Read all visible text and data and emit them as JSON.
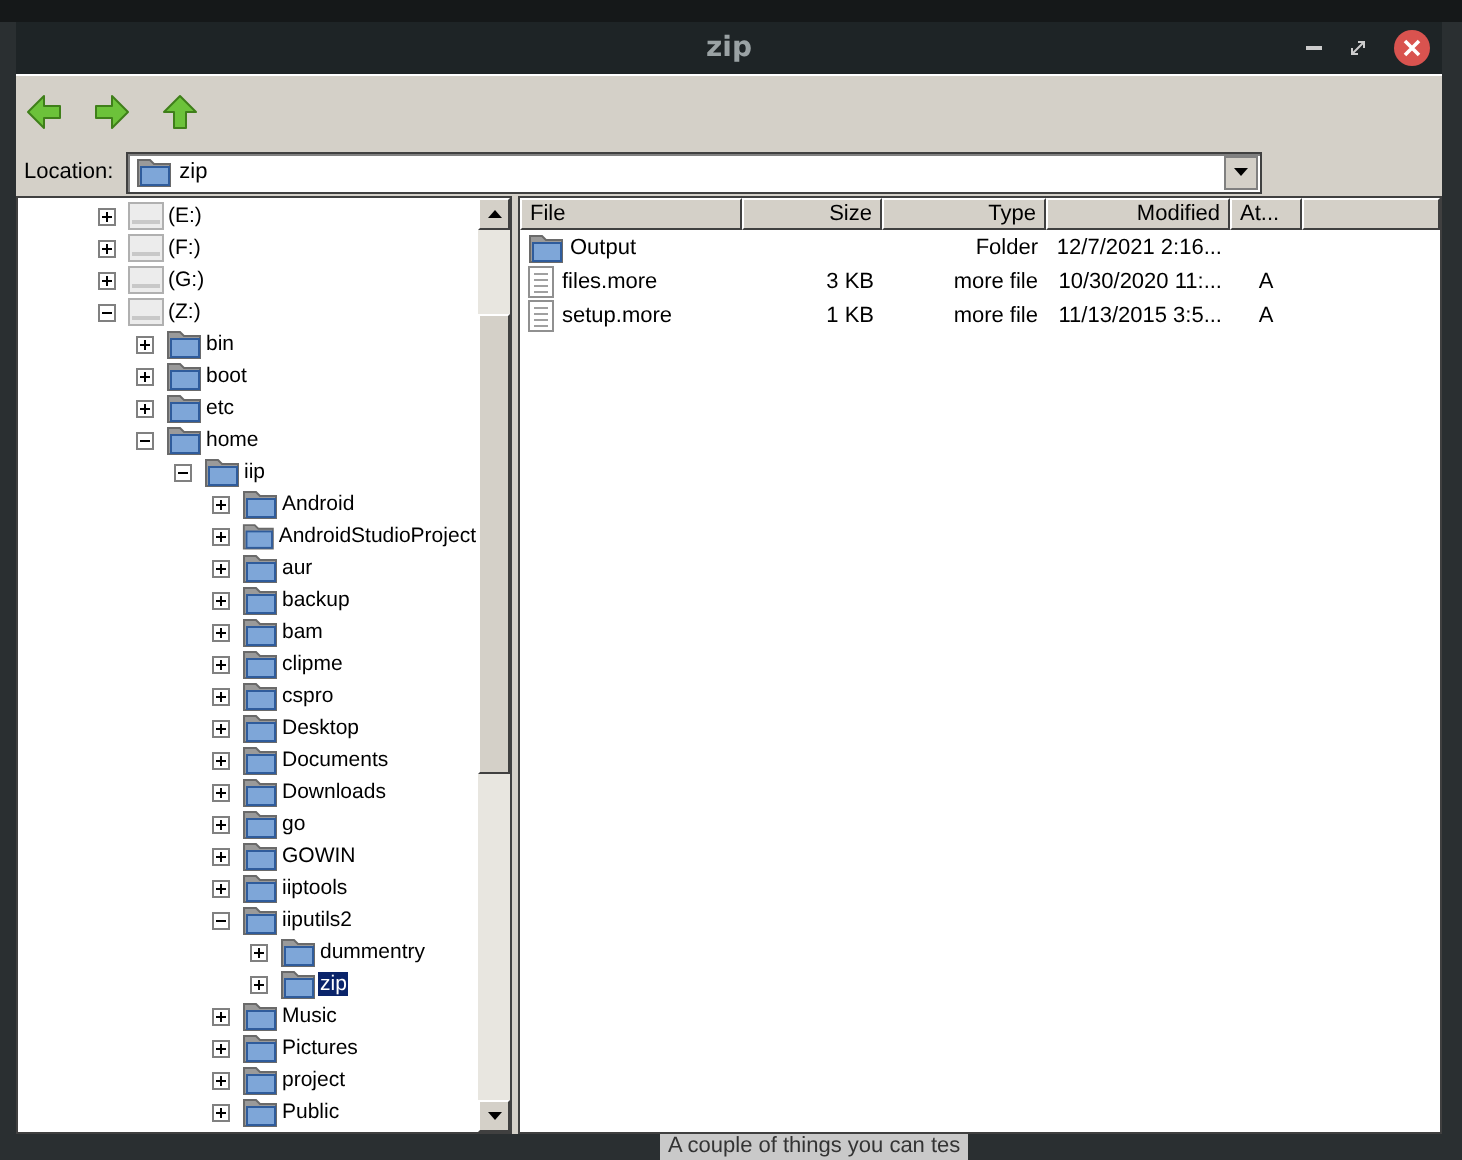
{
  "window": {
    "title": "zip"
  },
  "location": {
    "label": "Location:",
    "value": "zip"
  },
  "tree": [
    {
      "kind": "drive",
      "label": "(E:)",
      "expanded": false,
      "selected": false
    },
    {
      "kind": "drive",
      "label": "(F:)",
      "expanded": false,
      "selected": false
    },
    {
      "kind": "drive",
      "label": "(G:)",
      "expanded": false,
      "selected": false
    },
    {
      "kind": "drive",
      "label": "(Z:)",
      "expanded": true,
      "selected": false,
      "children": [
        {
          "kind": "folder",
          "label": "bin",
          "expanded": false,
          "selected": false
        },
        {
          "kind": "folder",
          "label": "boot",
          "expanded": false,
          "selected": false
        },
        {
          "kind": "folder",
          "label": "etc",
          "expanded": false,
          "selected": false
        },
        {
          "kind": "folder",
          "label": "home",
          "expanded": true,
          "selected": false,
          "children": [
            {
              "kind": "folder",
              "label": "iip",
              "expanded": true,
              "selected": false,
              "children": [
                {
                  "kind": "folder",
                  "label": "Android",
                  "expanded": false,
                  "selected": false
                },
                {
                  "kind": "folder",
                  "label": "AndroidStudioProject",
                  "expanded": false,
                  "selected": false
                },
                {
                  "kind": "folder",
                  "label": "aur",
                  "expanded": false,
                  "selected": false
                },
                {
                  "kind": "folder",
                  "label": "backup",
                  "expanded": false,
                  "selected": false
                },
                {
                  "kind": "folder",
                  "label": "bam",
                  "expanded": false,
                  "selected": false
                },
                {
                  "kind": "folder",
                  "label": "clipme",
                  "expanded": false,
                  "selected": false
                },
                {
                  "kind": "folder",
                  "label": "cspro",
                  "expanded": false,
                  "selected": false
                },
                {
                  "kind": "folder",
                  "label": "Desktop",
                  "expanded": false,
                  "selected": false
                },
                {
                  "kind": "folder",
                  "label": "Documents",
                  "expanded": false,
                  "selected": false
                },
                {
                  "kind": "folder",
                  "label": "Downloads",
                  "expanded": false,
                  "selected": false
                },
                {
                  "kind": "folder",
                  "label": "go",
                  "expanded": false,
                  "selected": false
                },
                {
                  "kind": "folder",
                  "label": "GOWIN",
                  "expanded": false,
                  "selected": false
                },
                {
                  "kind": "folder",
                  "label": "iiptools",
                  "expanded": false,
                  "selected": false
                },
                {
                  "kind": "folder",
                  "label": "iiputils2",
                  "expanded": true,
                  "selected": false,
                  "children": [
                    {
                      "kind": "folder",
                      "label": "dummentry",
                      "expanded": false,
                      "selected": false
                    },
                    {
                      "kind": "folder",
                      "label": "zip",
                      "expanded": false,
                      "selected": true
                    }
                  ]
                },
                {
                  "kind": "folder",
                  "label": "Music",
                  "expanded": false,
                  "selected": false
                },
                {
                  "kind": "folder",
                  "label": "Pictures",
                  "expanded": false,
                  "selected": false
                },
                {
                  "kind": "folder",
                  "label": "project",
                  "expanded": false,
                  "selected": false
                },
                {
                  "kind": "folder",
                  "label": "Public",
                  "expanded": false,
                  "selected": false
                }
              ]
            }
          ]
        }
      ]
    }
  ],
  "table": {
    "columns": [
      {
        "label": "File"
      },
      {
        "label": "Size"
      },
      {
        "label": "Type"
      },
      {
        "label": "Modified"
      },
      {
        "label": "At..."
      }
    ],
    "rows": [
      {
        "kind": "folder",
        "cells": [
          "Output",
          "",
          "Folder",
          "12/7/2021 2:16...",
          ""
        ]
      },
      {
        "kind": "file",
        "cells": [
          "files.more",
          "3 KB",
          "more file",
          "10/30/2020 11:...",
          "A"
        ]
      },
      {
        "kind": "file",
        "cells": [
          "setup.more",
          "1 KB",
          "more file",
          "11/13/2015 3:5...",
          "A"
        ]
      }
    ]
  },
  "background_text": "A couple of things you can tes"
}
